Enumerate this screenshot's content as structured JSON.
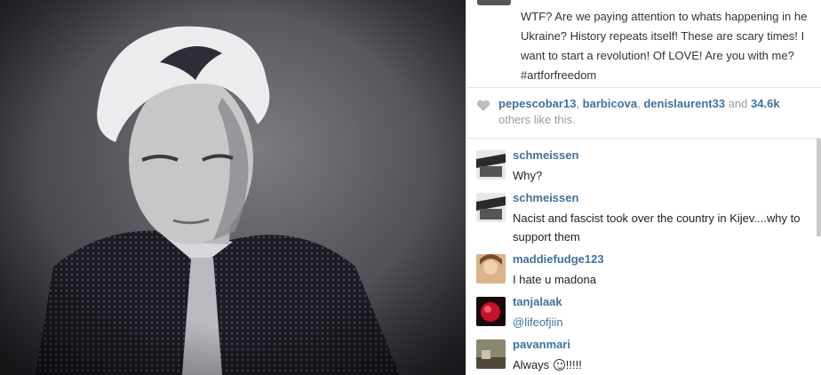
{
  "post": {
    "caption": "WTF? Are we paying attention to whats happening in he Ukraine? History repeats itself! These are scary times! I want to start a revolution! Of LOVE! Are you with me? #artforfreedom",
    "likes": {
      "users": [
        "pepescobar13",
        "barbicova",
        "denislaurent33"
      ],
      "sep1": ", ",
      "sep2": ", ",
      "and_text": " and ",
      "count": "34.6k",
      "suffix": "others like this."
    }
  },
  "comments": [
    {
      "username": "schmeissen",
      "text": "Why?",
      "avatar_color": "#3a3a3a"
    },
    {
      "username": "schmeissen",
      "text": "Nacist and fascist took over the country in Kijev....why to support them",
      "avatar_color": "#3a3a3a"
    },
    {
      "username": "maddiefudge123",
      "text": "I hate u madona",
      "avatar_color": "#c9a27a"
    },
    {
      "username": "tanjalaak",
      "text": "@lifeofjiin",
      "avatar_color": "#b01020"
    },
    {
      "username": "pavanmari",
      "text_before": "Always ",
      "text_after": "!!!!!",
      "avatar_color": "#6d6a58"
    }
  ],
  "icons": {
    "like": "heart-icon",
    "emoji": "smiley-icon"
  },
  "colors": {
    "link": "#3f729b",
    "text": "#333333",
    "muted": "#9b9b9b"
  }
}
